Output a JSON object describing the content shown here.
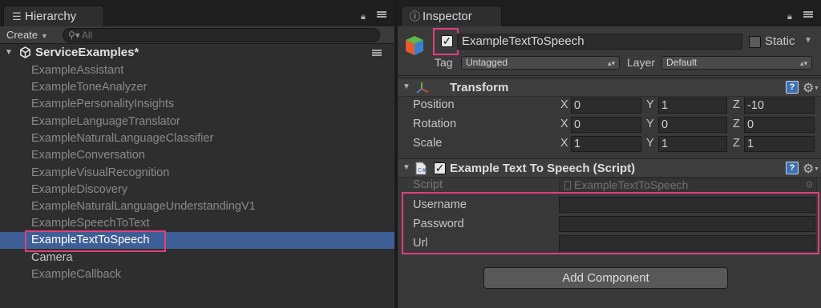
{
  "hierarchy": {
    "tab_label": "Hierarchy",
    "create_label": "Create",
    "search_placeholder": "All",
    "scene_name": "ServiceExamples*",
    "items": [
      "ExampleAssistant",
      "ExampleToneAnalyzer",
      "ExamplePersonalityInsights",
      "ExampleLanguageTranslator",
      "ExampleNaturalLanguageClassifier",
      "ExampleConversation",
      "ExampleVisualRecognition",
      "ExampleDiscovery",
      "ExampleNaturalLanguageUnderstandingV1",
      "ExampleSpeechToText",
      "ExampleTextToSpeech",
      "Camera",
      "ExampleCallback"
    ],
    "selected_index": 10
  },
  "inspector": {
    "tab_label": "Inspector",
    "object_name": "ExampleTextToSpeech",
    "active_checked": true,
    "static_label": "Static",
    "tag_label": "Tag",
    "tag_value": "Untagged",
    "layer_label": "Layer",
    "layer_value": "Default",
    "transform": {
      "title": "Transform",
      "rows": [
        {
          "label": "Position",
          "x": "0",
          "y": "1",
          "z": "-10"
        },
        {
          "label": "Rotation",
          "x": "0",
          "y": "0",
          "z": "0"
        },
        {
          "label": "Scale",
          "x": "1",
          "y": "1",
          "z": "1"
        }
      ],
      "axis_x": "X",
      "axis_y": "Y",
      "axis_z": "Z"
    },
    "script_component": {
      "title": "Example Text To Speech (Script)",
      "script_label": "Script",
      "script_value": "ExampleTextToSpeech",
      "fields": [
        {
          "label": "Username",
          "value": ""
        },
        {
          "label": "Password",
          "value": ""
        },
        {
          "label": "Url",
          "value": ""
        }
      ]
    },
    "add_component_label": "Add Component"
  },
  "colors": {
    "selection": "#3e5f96",
    "highlight_box": "#e0407a",
    "help_icon": "#3f6fb3"
  }
}
